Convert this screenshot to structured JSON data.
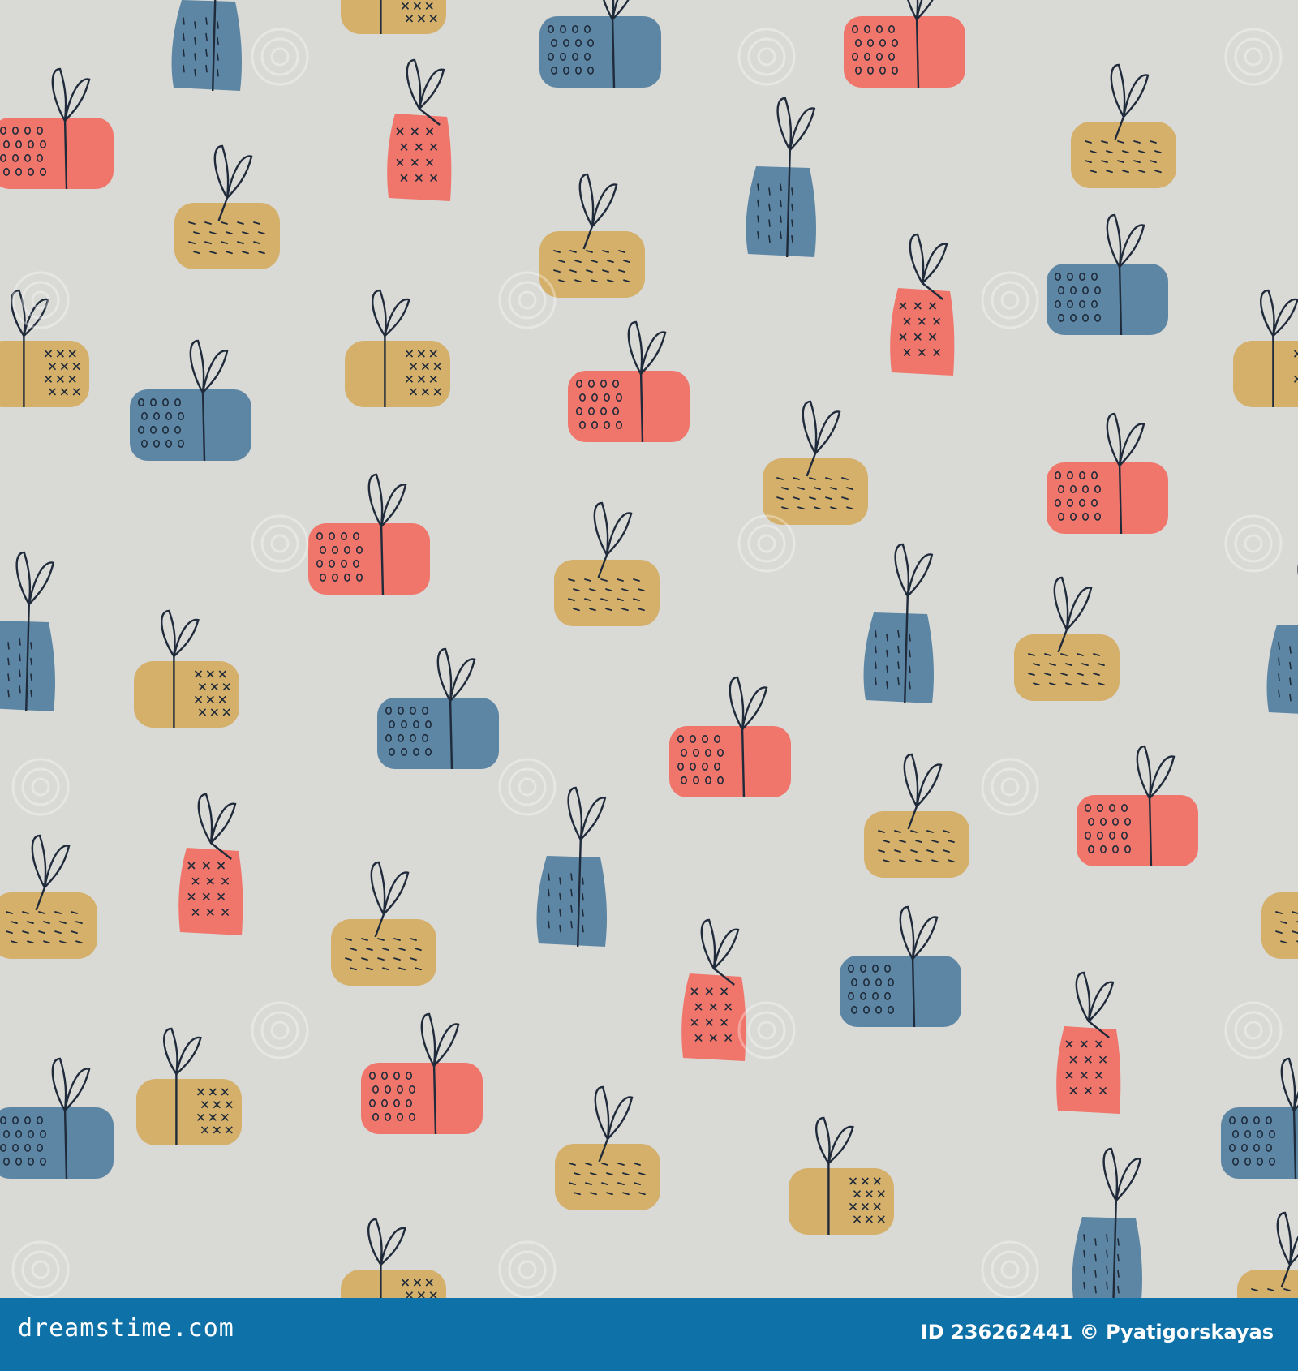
{
  "colors": {
    "background": "#d9d9d6",
    "red": "#f0756a",
    "blue": "#5c86a3",
    "mustard": "#d4b06a",
    "ink": "#1f2a3a",
    "footer": "#0e72a8"
  },
  "footer": {
    "brand": "dreamstime.com",
    "credit": "ID 236262441 © Pyatigorskayas"
  },
  "watermark": {
    "text": "dreamstime",
    "icon": "spiral-logo-icon"
  }
}
